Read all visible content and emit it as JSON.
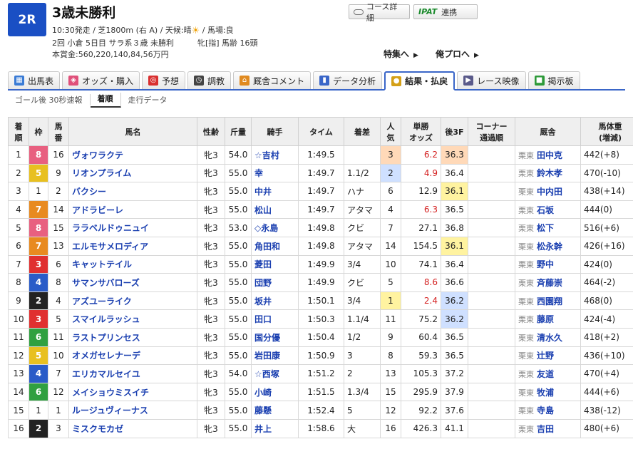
{
  "race": {
    "badge": "2R",
    "title": "3歳未勝利",
    "info_before_sun": "10:30発走 / 芝1800m (右 A) / 天候:晴",
    "info_after_sun": " / 馬場:良",
    "info2": "2回 小倉 5日目 サラ系３歳 未勝利　　　牝[指] 馬齢 16頭",
    "info3": "本賞金:560,220,140,84,56万円"
  },
  "buttons": {
    "course": "コース詳細",
    "ipat_logo": "IPAT",
    "ipat_label": "連携"
  },
  "features": {
    "feature": "特集へ",
    "orepro": "俺プロへ"
  },
  "tabs": [
    {
      "label": "出馬表",
      "icon": "table-icon",
      "color": "#3a7bd5"
    },
    {
      "label": "オッズ・購入",
      "icon": "odds-icon",
      "color": "#e0507a"
    },
    {
      "label": "予想",
      "icon": "target-icon",
      "color": "#d93030"
    },
    {
      "label": "調教",
      "icon": "stopwatch-icon",
      "color": "#444444"
    },
    {
      "label": "厩舎コメント",
      "icon": "stable-icon",
      "color": "#e08a20"
    },
    {
      "label": "データ分析",
      "icon": "bar-chart-icon",
      "color": "#3a66c8"
    },
    {
      "label": "結果・払戻",
      "icon": "coins-icon",
      "color": "#d4a017"
    },
    {
      "label": "レース映像",
      "icon": "video-icon",
      "color": "#5a5a8a"
    },
    {
      "label": "掲示板",
      "icon": "board-icon",
      "color": "#2e9a3a"
    }
  ],
  "subtabs": [
    "ゴール後 30秒速報",
    "着順",
    "走行データ"
  ],
  "columns": {
    "rank_top": "着",
    "rank_bottom": "順",
    "frame": "枠",
    "num_top": "馬",
    "num_bottom": "番",
    "name": "馬名",
    "sexage": "性齢",
    "weight": "斤量",
    "jockey": "騎手",
    "time": "タイム",
    "margin": "着差",
    "pop_top": "人",
    "pop_bottom": "気",
    "odds_top": "単勝",
    "odds_bottom": "オッズ",
    "f3": "後3F",
    "corner_top": "コーナー",
    "corner_bottom": "通過順",
    "trainer": "厩舎",
    "bw_top": "馬体重",
    "bw_bottom": "(増減)"
  },
  "frame_colors": {
    "1": "#ffffff",
    "2": "#222222",
    "3": "#e03030",
    "4": "#2a5cc8",
    "5": "#e8c020",
    "6": "#30a040",
    "7": "#e88a20",
    "8": "#e86080"
  },
  "rows": [
    {
      "rank": "1",
      "frame": "8",
      "num": "16",
      "name": "ヴォワラクテ",
      "sexage": "牝3",
      "weight": "54.0",
      "jockey": "☆吉村",
      "time": "1:49.5",
      "margin": "",
      "pop": "3",
      "odds": "6.2",
      "f3": "36.3",
      "corner": "",
      "region": "栗東",
      "trainer": "田中克",
      "bw": "442(+8)"
    },
    {
      "rank": "2",
      "frame": "5",
      "num": "9",
      "name": "リオンプライム",
      "sexage": "牝3",
      "weight": "55.0",
      "jockey": "幸",
      "time": "1:49.7",
      "margin": "1.1/2",
      "pop": "2",
      "odds": "4.9",
      "f3": "36.4",
      "corner": "",
      "region": "栗東",
      "trainer": "鈴木孝",
      "bw": "470(-10)"
    },
    {
      "rank": "3",
      "frame": "1",
      "num": "2",
      "name": "バクシー",
      "sexage": "牝3",
      "weight": "55.0",
      "jockey": "中井",
      "time": "1:49.7",
      "margin": "ハナ",
      "pop": "6",
      "odds": "12.9",
      "f3": "36.1",
      "corner": "",
      "region": "栗東",
      "trainer": "中内田",
      "bw": "438(+14)"
    },
    {
      "rank": "4",
      "frame": "7",
      "num": "14",
      "name": "アドラビーレ",
      "sexage": "牝3",
      "weight": "55.0",
      "jockey": "松山",
      "time": "1:49.7",
      "margin": "アタマ",
      "pop": "4",
      "odds": "6.3",
      "f3": "36.5",
      "corner": "",
      "region": "栗東",
      "trainer": "石坂",
      "bw": "444(0)"
    },
    {
      "rank": "5",
      "frame": "8",
      "num": "15",
      "name": "ララベルドゥニュイ",
      "sexage": "牝3",
      "weight": "53.0",
      "jockey": "◇永島",
      "time": "1:49.8",
      "margin": "クビ",
      "pop": "7",
      "odds": "27.1",
      "f3": "36.8",
      "corner": "",
      "region": "栗東",
      "trainer": "松下",
      "bw": "516(+6)"
    },
    {
      "rank": "6",
      "frame": "7",
      "num": "13",
      "name": "エルモサメロディア",
      "sexage": "牝3",
      "weight": "55.0",
      "jockey": "角田和",
      "time": "1:49.8",
      "margin": "アタマ",
      "pop": "14",
      "odds": "154.5",
      "f3": "36.1",
      "corner": "",
      "region": "栗東",
      "trainer": "松永幹",
      "bw": "426(+16)"
    },
    {
      "rank": "7",
      "frame": "3",
      "num": "6",
      "name": "キャットテイル",
      "sexage": "牝3",
      "weight": "55.0",
      "jockey": "菱田",
      "time": "1:49.9",
      "margin": "3/4",
      "pop": "10",
      "odds": "74.1",
      "f3": "36.4",
      "corner": "",
      "region": "栗東",
      "trainer": "野中",
      "bw": "424(0)"
    },
    {
      "rank": "8",
      "frame": "4",
      "num": "8",
      "name": "サマンサバローズ",
      "sexage": "牝3",
      "weight": "55.0",
      "jockey": "団野",
      "time": "1:49.9",
      "margin": "クビ",
      "pop": "5",
      "odds": "8.6",
      "f3": "36.6",
      "corner": "",
      "region": "栗東",
      "trainer": "斉藤崇",
      "bw": "464(-2)"
    },
    {
      "rank": "9",
      "frame": "2",
      "num": "4",
      "name": "アズユーライク",
      "sexage": "牝3",
      "weight": "55.0",
      "jockey": "坂井",
      "time": "1:50.1",
      "margin": "3/4",
      "pop": "1",
      "odds": "2.4",
      "f3": "36.2",
      "corner": "",
      "region": "栗東",
      "trainer": "西園翔",
      "bw": "468(0)"
    },
    {
      "rank": "10",
      "frame": "3",
      "num": "5",
      "name": "スマイルラッシュ",
      "sexage": "牝3",
      "weight": "55.0",
      "jockey": "田口",
      "time": "1:50.3",
      "margin": "1.1/4",
      "pop": "11",
      "odds": "75.2",
      "f3": "36.2",
      "corner": "",
      "region": "栗東",
      "trainer": "藤原",
      "bw": "424(-4)"
    },
    {
      "rank": "11",
      "frame": "6",
      "num": "11",
      "name": "ラストプリンセス",
      "sexage": "牝3",
      "weight": "55.0",
      "jockey": "国分優",
      "time": "1:50.4",
      "margin": "1/2",
      "pop": "9",
      "odds": "60.4",
      "f3": "36.5",
      "corner": "",
      "region": "栗東",
      "trainer": "清水久",
      "bw": "418(+2)"
    },
    {
      "rank": "12",
      "frame": "5",
      "num": "10",
      "name": "オメガセレナーデ",
      "sexage": "牝3",
      "weight": "55.0",
      "jockey": "岩田康",
      "time": "1:50.9",
      "margin": "3",
      "pop": "8",
      "odds": "59.3",
      "f3": "36.5",
      "corner": "",
      "region": "栗東",
      "trainer": "辻野",
      "bw": "436(+10)"
    },
    {
      "rank": "13",
      "frame": "4",
      "num": "7",
      "name": "エリカマルセイユ",
      "sexage": "牝3",
      "weight": "54.0",
      "jockey": "☆西塚",
      "time": "1:51.2",
      "margin": "2",
      "pop": "13",
      "odds": "105.3",
      "f3": "37.2",
      "corner": "",
      "region": "栗東",
      "trainer": "友道",
      "bw": "470(+4)"
    },
    {
      "rank": "14",
      "frame": "6",
      "num": "12",
      "name": "メイショウミスイチ",
      "sexage": "牝3",
      "weight": "55.0",
      "jockey": "小崎",
      "time": "1:51.5",
      "margin": "1.3/4",
      "pop": "15",
      "odds": "295.9",
      "f3": "37.9",
      "corner": "",
      "region": "栗東",
      "trainer": "牧浦",
      "bw": "444(+6)"
    },
    {
      "rank": "15",
      "frame": "1",
      "num": "1",
      "name": "ルージュヴィーナス",
      "sexage": "牝3",
      "weight": "55.0",
      "jockey": "藤懸",
      "time": "1:52.4",
      "margin": "5",
      "pop": "12",
      "odds": "92.2",
      "f3": "37.6",
      "corner": "",
      "region": "栗東",
      "trainer": "寺島",
      "bw": "438(-12)"
    },
    {
      "rank": "16",
      "frame": "2",
      "num": "3",
      "name": "ミスクモカゼ",
      "sexage": "牝3",
      "weight": "55.0",
      "jockey": "井上",
      "time": "1:58.6",
      "margin": "大",
      "pop": "16",
      "odds": "426.3",
      "f3": "41.1",
      "corner": "",
      "region": "栗東",
      "trainer": "吉田",
      "bw": "480(+6)"
    }
  ]
}
